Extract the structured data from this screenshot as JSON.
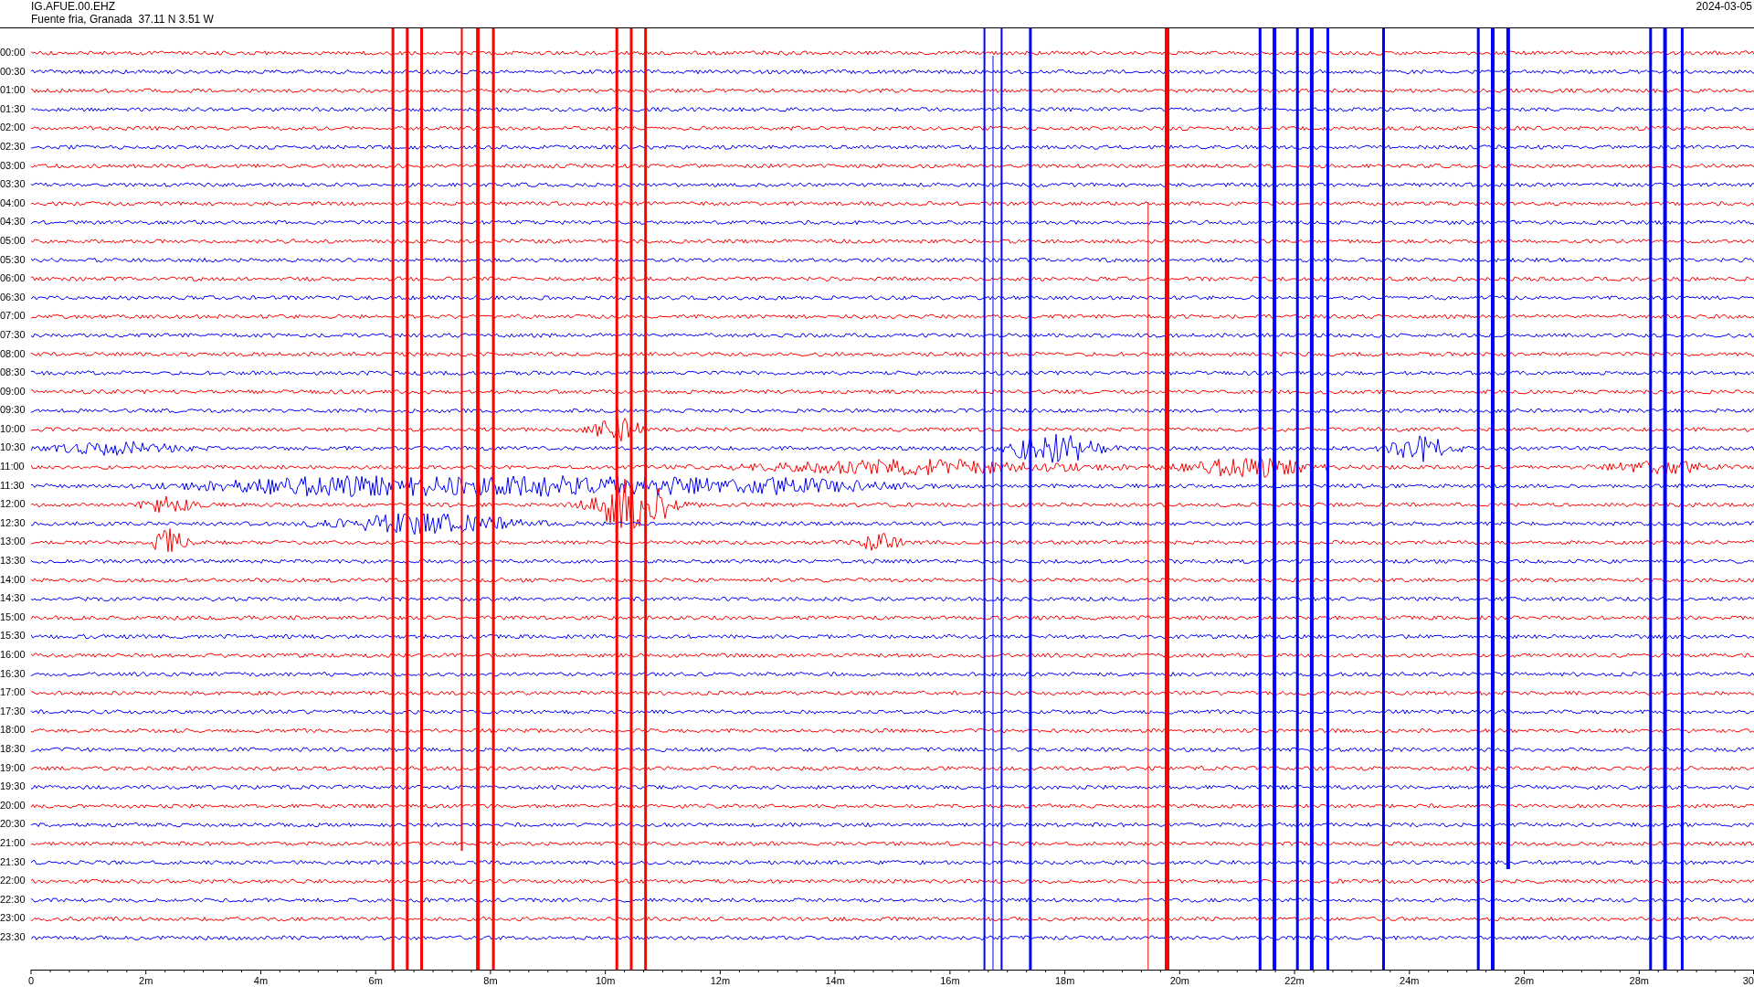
{
  "header": {
    "station": "IG.AFUE.00.EHZ",
    "location": "Fuente fria, Granada  37.11 N 3.51 W",
    "date": "2024-03-05"
  },
  "rows": [
    {
      "time": "00:00",
      "color": "#ff0000"
    },
    {
      "time": "00:30",
      "color": "#0000ff"
    },
    {
      "time": "01:00",
      "color": "#ff0000"
    },
    {
      "time": "01:30",
      "color": "#0000ff"
    },
    {
      "time": "02:00",
      "color": "#ff0000"
    },
    {
      "time": "02:30",
      "color": "#0000ff"
    },
    {
      "time": "03:00",
      "color": "#ff0000"
    },
    {
      "time": "03:30",
      "color": "#0000ff"
    },
    {
      "time": "04:00",
      "color": "#ff0000"
    },
    {
      "time": "04:30",
      "color": "#0000ff"
    },
    {
      "time": "05:00",
      "color": "#ff0000"
    },
    {
      "time": "05:30",
      "color": "#0000ff"
    },
    {
      "time": "06:00",
      "color": "#ff0000"
    },
    {
      "time": "06:30",
      "color": "#0000ff"
    },
    {
      "time": "07:00",
      "color": "#ff0000"
    },
    {
      "time": "07:30",
      "color": "#0000ff"
    },
    {
      "time": "08:00",
      "color": "#ff0000"
    },
    {
      "time": "08:30",
      "color": "#0000ff"
    },
    {
      "time": "09:00",
      "color": "#ff0000"
    },
    {
      "time": "09:30",
      "color": "#0000ff"
    },
    {
      "time": "10:00",
      "color": "#ff0000"
    },
    {
      "time": "10:30",
      "color": "#0000ff"
    },
    {
      "time": "11:00",
      "color": "#ff0000"
    },
    {
      "time": "11:30",
      "color": "#0000ff"
    },
    {
      "time": "12:00",
      "color": "#ff0000"
    },
    {
      "time": "12:30",
      "color": "#0000ff"
    },
    {
      "time": "13:00",
      "color": "#ff0000"
    },
    {
      "time": "13:30",
      "color": "#0000ff"
    },
    {
      "time": "14:00",
      "color": "#ff0000"
    },
    {
      "time": "14:30",
      "color": "#0000ff"
    },
    {
      "time": "15:00",
      "color": "#ff0000"
    },
    {
      "time": "15:30",
      "color": "#0000ff"
    },
    {
      "time": "16:00",
      "color": "#ff0000"
    },
    {
      "time": "16:30",
      "color": "#0000ff"
    },
    {
      "time": "17:00",
      "color": "#ff0000"
    },
    {
      "time": "17:30",
      "color": "#0000ff"
    },
    {
      "time": "18:00",
      "color": "#ff0000"
    },
    {
      "time": "18:30",
      "color": "#0000ff"
    },
    {
      "time": "19:00",
      "color": "#ff0000"
    },
    {
      "time": "19:30",
      "color": "#0000ff"
    },
    {
      "time": "20:00",
      "color": "#ff0000"
    },
    {
      "time": "20:30",
      "color": "#0000ff"
    },
    {
      "time": "21:00",
      "color": "#ff0000"
    },
    {
      "time": "21:30",
      "color": "#0000ff"
    },
    {
      "time": "22:00",
      "color": "#ff0000"
    },
    {
      "time": "22:30",
      "color": "#0000ff"
    },
    {
      "time": "23:00",
      "color": "#ff0000"
    },
    {
      "time": "23:30",
      "color": "#0000ff"
    }
  ],
  "x_axis": {
    "ticks": [
      "0",
      "2m",
      "4m",
      "6m",
      "8m",
      "10m",
      "12m",
      "14m",
      "16m",
      "18m",
      "20m",
      "22m",
      "24m",
      "26m",
      "28m",
      "30"
    ]
  }
}
